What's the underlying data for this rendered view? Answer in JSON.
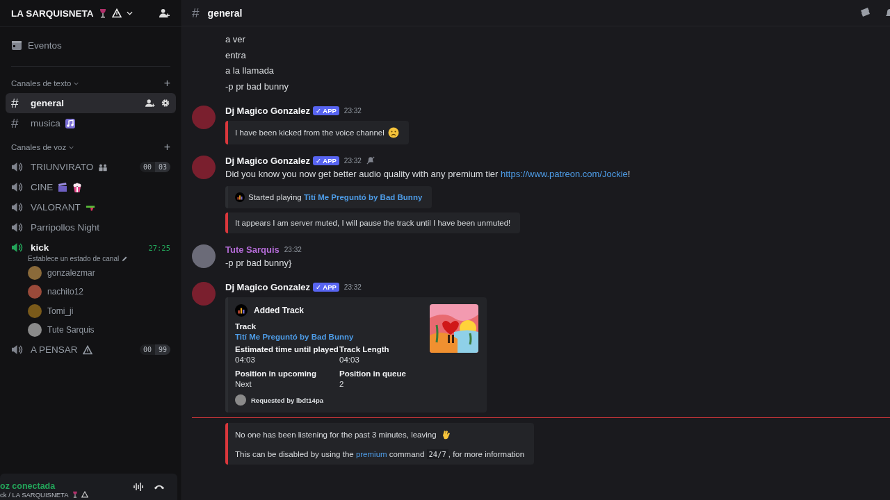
{
  "server": {
    "name": "LA SARQUISNETA",
    "decor": [
      {
        "kind": "wine"
      },
      {
        "kind": "warning"
      }
    ]
  },
  "events": {
    "label": "Eventos"
  },
  "text_category": {
    "label": "Canales de texto",
    "add": "+"
  },
  "text_channels": [
    {
      "prefix": "#",
      "name": "general",
      "selected": true
    },
    {
      "prefix": "#",
      "name": "musica",
      "selected": false,
      "decor": [
        {
          "kind": "music"
        }
      ]
    }
  ],
  "voice_category": {
    "label": "Canales de voz",
    "add": "+"
  },
  "voice_channels": [
    {
      "name": "TRIUNVIRATO",
      "decor": [
        {
          "kind": "people"
        }
      ],
      "active": false,
      "limit": [
        "00",
        "03"
      ]
    },
    {
      "name": "CINE",
      "decor": [
        {
          "kind": "clapper"
        },
        {
          "kind": "popcorn"
        }
      ],
      "active": false
    },
    {
      "name": "VALORANT",
      "decor": [
        {
          "kind": "gun"
        }
      ],
      "active": false
    },
    {
      "name": "Parripollos Night",
      "active": false
    },
    {
      "name": "kick",
      "active": true,
      "timer": "27:25",
      "status": "Establece un estado de canal",
      "members": [
        {
          "name": "gonzalezmar",
          "color": "#8a6a3a"
        },
        {
          "name": "nachito12",
          "color": "#9a4a3a"
        },
        {
          "name": "Tomi_ji",
          "color": "#7a5a1a"
        },
        {
          "name": "Tute Sarquis",
          "color": "#8a8a8a"
        }
      ]
    },
    {
      "name": "A PENSAR",
      "decor": [
        {
          "kind": "warning"
        }
      ],
      "active": false,
      "limit": [
        "00",
        "99"
      ]
    }
  ],
  "voice_panel": {
    "status": "oz conectada",
    "location": "ck / LA SARQUISNETA",
    "decor": [
      {
        "kind": "wine"
      },
      {
        "kind": "warning"
      }
    ]
  },
  "header": {
    "prefix": "#",
    "channel": "general"
  },
  "messages": [
    {
      "kind": "lines",
      "lines": [
        "a ver",
        "entra",
        "a la llamada",
        "-p pr bad bunny"
      ]
    },
    {
      "kind": "group",
      "avatar": {
        "color": "#7a1f2e"
      },
      "author": {
        "name": "Dj Magico Gonzalez",
        "color": "#f2f3f5"
      },
      "badge": "✓ APP",
      "time": "23:32",
      "muted": false,
      "blocks": [
        {
          "kind": "note",
          "color": "#da373c",
          "text": "I have been kicked from the voice channel",
          "emoji": {
            "kind": "sad"
          }
        }
      ]
    },
    {
      "kind": "group",
      "avatar": {
        "color": "#7a1f2e"
      },
      "author": {
        "name": "Dj Magico Gonzalez",
        "color": "#f2f3f5"
      },
      "badge": "✓ APP",
      "time": "23:32",
      "muted": true,
      "blocks": [
        {
          "kind": "text",
          "parts": [
            {
              "text": "Did you know you now get better audio quality with any premium tier ",
              "link": false
            },
            {
              "text": "https://www.patreon.com/Jockie",
              "link": true
            },
            {
              "text": "!",
              "link": false
            }
          ]
        },
        {
          "kind": "playing",
          "color": "#2b2d31",
          "label": "Started playing",
          "track": "Tití Me Preguntó by Bad Bunny"
        },
        {
          "kind": "note",
          "color": "#da373c",
          "text": "It appears I am server muted, I will pause the track until I have been unmuted!"
        }
      ]
    },
    {
      "kind": "group",
      "avatar": {
        "color": "#6b6b78"
      },
      "author": {
        "name": "Tute Sarquis",
        "color": "#b36bd6"
      },
      "time": "23:32",
      "muted": false,
      "blocks": [
        {
          "kind": "text",
          "parts": [
            {
              "text": "-p pr bad bunny}",
              "link": false
            }
          ]
        }
      ]
    },
    {
      "kind": "group",
      "avatar": {
        "color": "#7a1f2e"
      },
      "author": {
        "name": "Dj Magico Gonzalez",
        "color": "#f2f3f5"
      },
      "badge": "✓ APP",
      "time": "23:32",
      "muted": false,
      "blocks": [
        {
          "kind": "track",
          "color": "#2b2d31",
          "title": "Added Track",
          "track_label": "Track",
          "track": "Tití Me Preguntó by Bad Bunny",
          "fields": [
            {
              "name": "Estimated time until played",
              "value": "04:03"
            },
            {
              "name": "Track Length",
              "value": "04:03"
            },
            {
              "name": "Position in upcoming",
              "value": "Next"
            },
            {
              "name": "Position in queue",
              "value": "2"
            }
          ],
          "footer": "Requested by lbdt14pa"
        }
      ]
    },
    {
      "kind": "divider"
    },
    {
      "kind": "leave",
      "color": "#da373c",
      "text": "No one has been listening for the past 3 minutes, leaving",
      "line_before": "This can be disabled by using the ",
      "link": "premium",
      "line_mid": " command ",
      "code": "24/7",
      "line_after": ", for more information"
    }
  ]
}
